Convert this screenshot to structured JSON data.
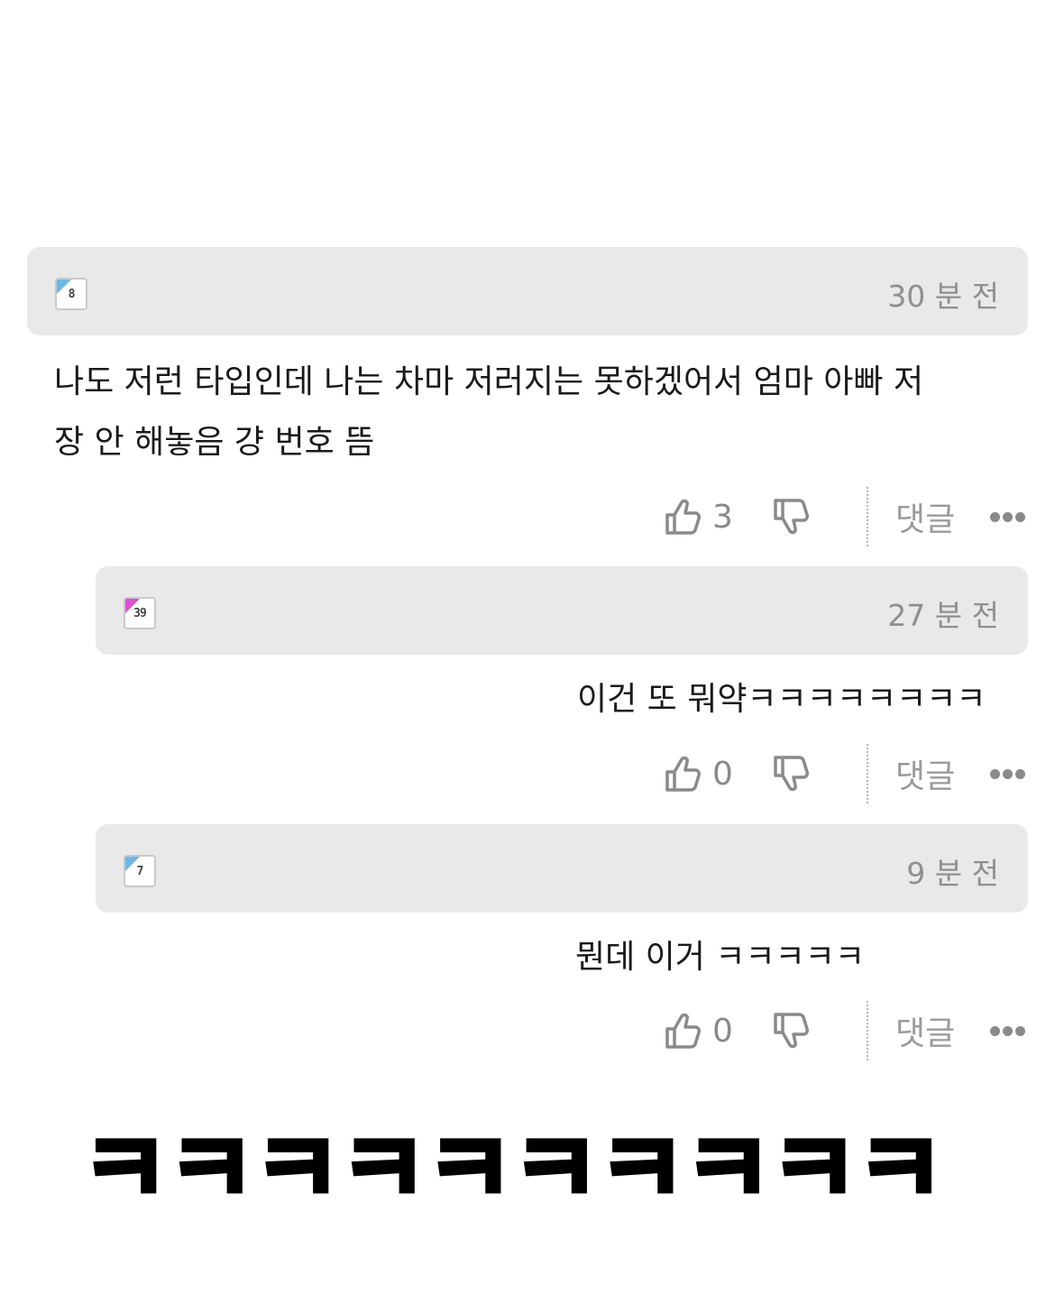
{
  "comments": [
    {
      "level": "8",
      "level_color": "#6bb6e8",
      "timestamp": "30 분 전",
      "text_lines": [
        "나도 저런 타입인데 나는 차마 저러지는 못하겠어서 엄마 아빠 저",
        "장 안 해놓음 걍 번호 뜸"
      ],
      "likes": "3",
      "reply_label": "댓글"
    },
    {
      "level": "39",
      "level_color": "#e04fd4",
      "timestamp": "27 분 전",
      "text_lines": [
        "이건 또 뭐약ㅋㅋㅋㅋㅋㅋㅋㅋ"
      ],
      "likes": "0",
      "reply_label": "댓글"
    },
    {
      "level": "7",
      "level_color": "#6bb6e8",
      "timestamp": "9 분 전",
      "text_lines": [
        "뭔데 이거 ㅋㅋㅋㅋㅋ"
      ],
      "likes": "0",
      "reply_label": "댓글"
    }
  ],
  "caption": "ㅋㅋㅋㅋㅋㅋㅋㅋㅋㅋ",
  "icons": {
    "like": "thumbs-up-icon",
    "dislike": "thumbs-down-icon",
    "more": "more-dots-icon"
  }
}
